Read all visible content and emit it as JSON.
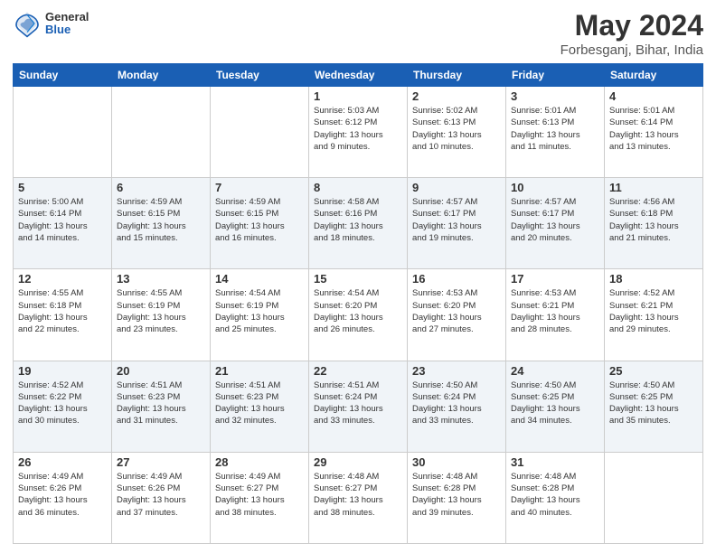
{
  "header": {
    "logo_general": "General",
    "logo_blue": "Blue",
    "month": "May 2024",
    "location": "Forbesganj, Bihar, India"
  },
  "weekdays": [
    "Sunday",
    "Monday",
    "Tuesday",
    "Wednesday",
    "Thursday",
    "Friday",
    "Saturday"
  ],
  "weeks": [
    [
      {
        "day": "",
        "info": ""
      },
      {
        "day": "",
        "info": ""
      },
      {
        "day": "",
        "info": ""
      },
      {
        "day": "1",
        "info": "Sunrise: 5:03 AM\nSunset: 6:12 PM\nDaylight: 13 hours\nand 9 minutes."
      },
      {
        "day": "2",
        "info": "Sunrise: 5:02 AM\nSunset: 6:13 PM\nDaylight: 13 hours\nand 10 minutes."
      },
      {
        "day": "3",
        "info": "Sunrise: 5:01 AM\nSunset: 6:13 PM\nDaylight: 13 hours\nand 11 minutes."
      },
      {
        "day": "4",
        "info": "Sunrise: 5:01 AM\nSunset: 6:14 PM\nDaylight: 13 hours\nand 13 minutes."
      }
    ],
    [
      {
        "day": "5",
        "info": "Sunrise: 5:00 AM\nSunset: 6:14 PM\nDaylight: 13 hours\nand 14 minutes."
      },
      {
        "day": "6",
        "info": "Sunrise: 4:59 AM\nSunset: 6:15 PM\nDaylight: 13 hours\nand 15 minutes."
      },
      {
        "day": "7",
        "info": "Sunrise: 4:59 AM\nSunset: 6:15 PM\nDaylight: 13 hours\nand 16 minutes."
      },
      {
        "day": "8",
        "info": "Sunrise: 4:58 AM\nSunset: 6:16 PM\nDaylight: 13 hours\nand 18 minutes."
      },
      {
        "day": "9",
        "info": "Sunrise: 4:57 AM\nSunset: 6:17 PM\nDaylight: 13 hours\nand 19 minutes."
      },
      {
        "day": "10",
        "info": "Sunrise: 4:57 AM\nSunset: 6:17 PM\nDaylight: 13 hours\nand 20 minutes."
      },
      {
        "day": "11",
        "info": "Sunrise: 4:56 AM\nSunset: 6:18 PM\nDaylight: 13 hours\nand 21 minutes."
      }
    ],
    [
      {
        "day": "12",
        "info": "Sunrise: 4:55 AM\nSunset: 6:18 PM\nDaylight: 13 hours\nand 22 minutes."
      },
      {
        "day": "13",
        "info": "Sunrise: 4:55 AM\nSunset: 6:19 PM\nDaylight: 13 hours\nand 23 minutes."
      },
      {
        "day": "14",
        "info": "Sunrise: 4:54 AM\nSunset: 6:19 PM\nDaylight: 13 hours\nand 25 minutes."
      },
      {
        "day": "15",
        "info": "Sunrise: 4:54 AM\nSunset: 6:20 PM\nDaylight: 13 hours\nand 26 minutes."
      },
      {
        "day": "16",
        "info": "Sunrise: 4:53 AM\nSunset: 6:20 PM\nDaylight: 13 hours\nand 27 minutes."
      },
      {
        "day": "17",
        "info": "Sunrise: 4:53 AM\nSunset: 6:21 PM\nDaylight: 13 hours\nand 28 minutes."
      },
      {
        "day": "18",
        "info": "Sunrise: 4:52 AM\nSunset: 6:21 PM\nDaylight: 13 hours\nand 29 minutes."
      }
    ],
    [
      {
        "day": "19",
        "info": "Sunrise: 4:52 AM\nSunset: 6:22 PM\nDaylight: 13 hours\nand 30 minutes."
      },
      {
        "day": "20",
        "info": "Sunrise: 4:51 AM\nSunset: 6:23 PM\nDaylight: 13 hours\nand 31 minutes."
      },
      {
        "day": "21",
        "info": "Sunrise: 4:51 AM\nSunset: 6:23 PM\nDaylight: 13 hours\nand 32 minutes."
      },
      {
        "day": "22",
        "info": "Sunrise: 4:51 AM\nSunset: 6:24 PM\nDaylight: 13 hours\nand 33 minutes."
      },
      {
        "day": "23",
        "info": "Sunrise: 4:50 AM\nSunset: 6:24 PM\nDaylight: 13 hours\nand 33 minutes."
      },
      {
        "day": "24",
        "info": "Sunrise: 4:50 AM\nSunset: 6:25 PM\nDaylight: 13 hours\nand 34 minutes."
      },
      {
        "day": "25",
        "info": "Sunrise: 4:50 AM\nSunset: 6:25 PM\nDaylight: 13 hours\nand 35 minutes."
      }
    ],
    [
      {
        "day": "26",
        "info": "Sunrise: 4:49 AM\nSunset: 6:26 PM\nDaylight: 13 hours\nand 36 minutes."
      },
      {
        "day": "27",
        "info": "Sunrise: 4:49 AM\nSunset: 6:26 PM\nDaylight: 13 hours\nand 37 minutes."
      },
      {
        "day": "28",
        "info": "Sunrise: 4:49 AM\nSunset: 6:27 PM\nDaylight: 13 hours\nand 38 minutes."
      },
      {
        "day": "29",
        "info": "Sunrise: 4:48 AM\nSunset: 6:27 PM\nDaylight: 13 hours\nand 38 minutes."
      },
      {
        "day": "30",
        "info": "Sunrise: 4:48 AM\nSunset: 6:28 PM\nDaylight: 13 hours\nand 39 minutes."
      },
      {
        "day": "31",
        "info": "Sunrise: 4:48 AM\nSunset: 6:28 PM\nDaylight: 13 hours\nand 40 minutes."
      },
      {
        "day": "",
        "info": ""
      }
    ]
  ]
}
